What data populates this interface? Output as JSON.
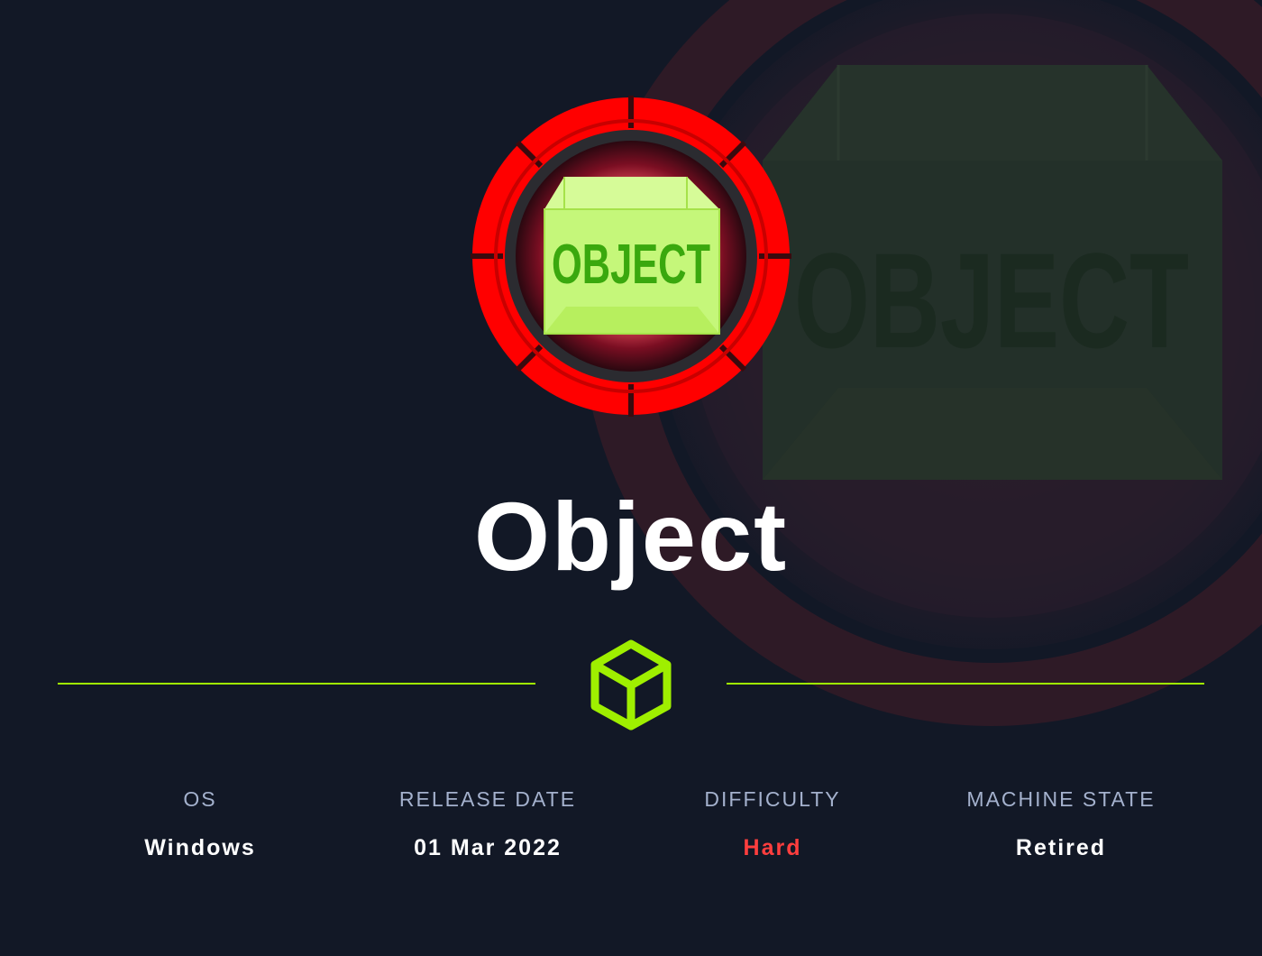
{
  "machine": {
    "name": "Object",
    "logo_text": "OBJECT",
    "logo_icon": "box-logo-icon"
  },
  "divider": {
    "icon": "cube-icon"
  },
  "stats": [
    {
      "label": "OS",
      "value": "Windows"
    },
    {
      "label": "RELEASE DATE",
      "value": "01 Mar 2022"
    },
    {
      "label": "DIFFICULTY",
      "value": "Hard"
    },
    {
      "label": "MACHINE STATE",
      "value": "Retired"
    }
  ],
  "colors": {
    "background": "#121826",
    "accent_green": "#9fef00",
    "difficulty_hard": "#ff3e3e",
    "label_gray": "#a4b1cd",
    "badge_red": "#ff0000"
  }
}
